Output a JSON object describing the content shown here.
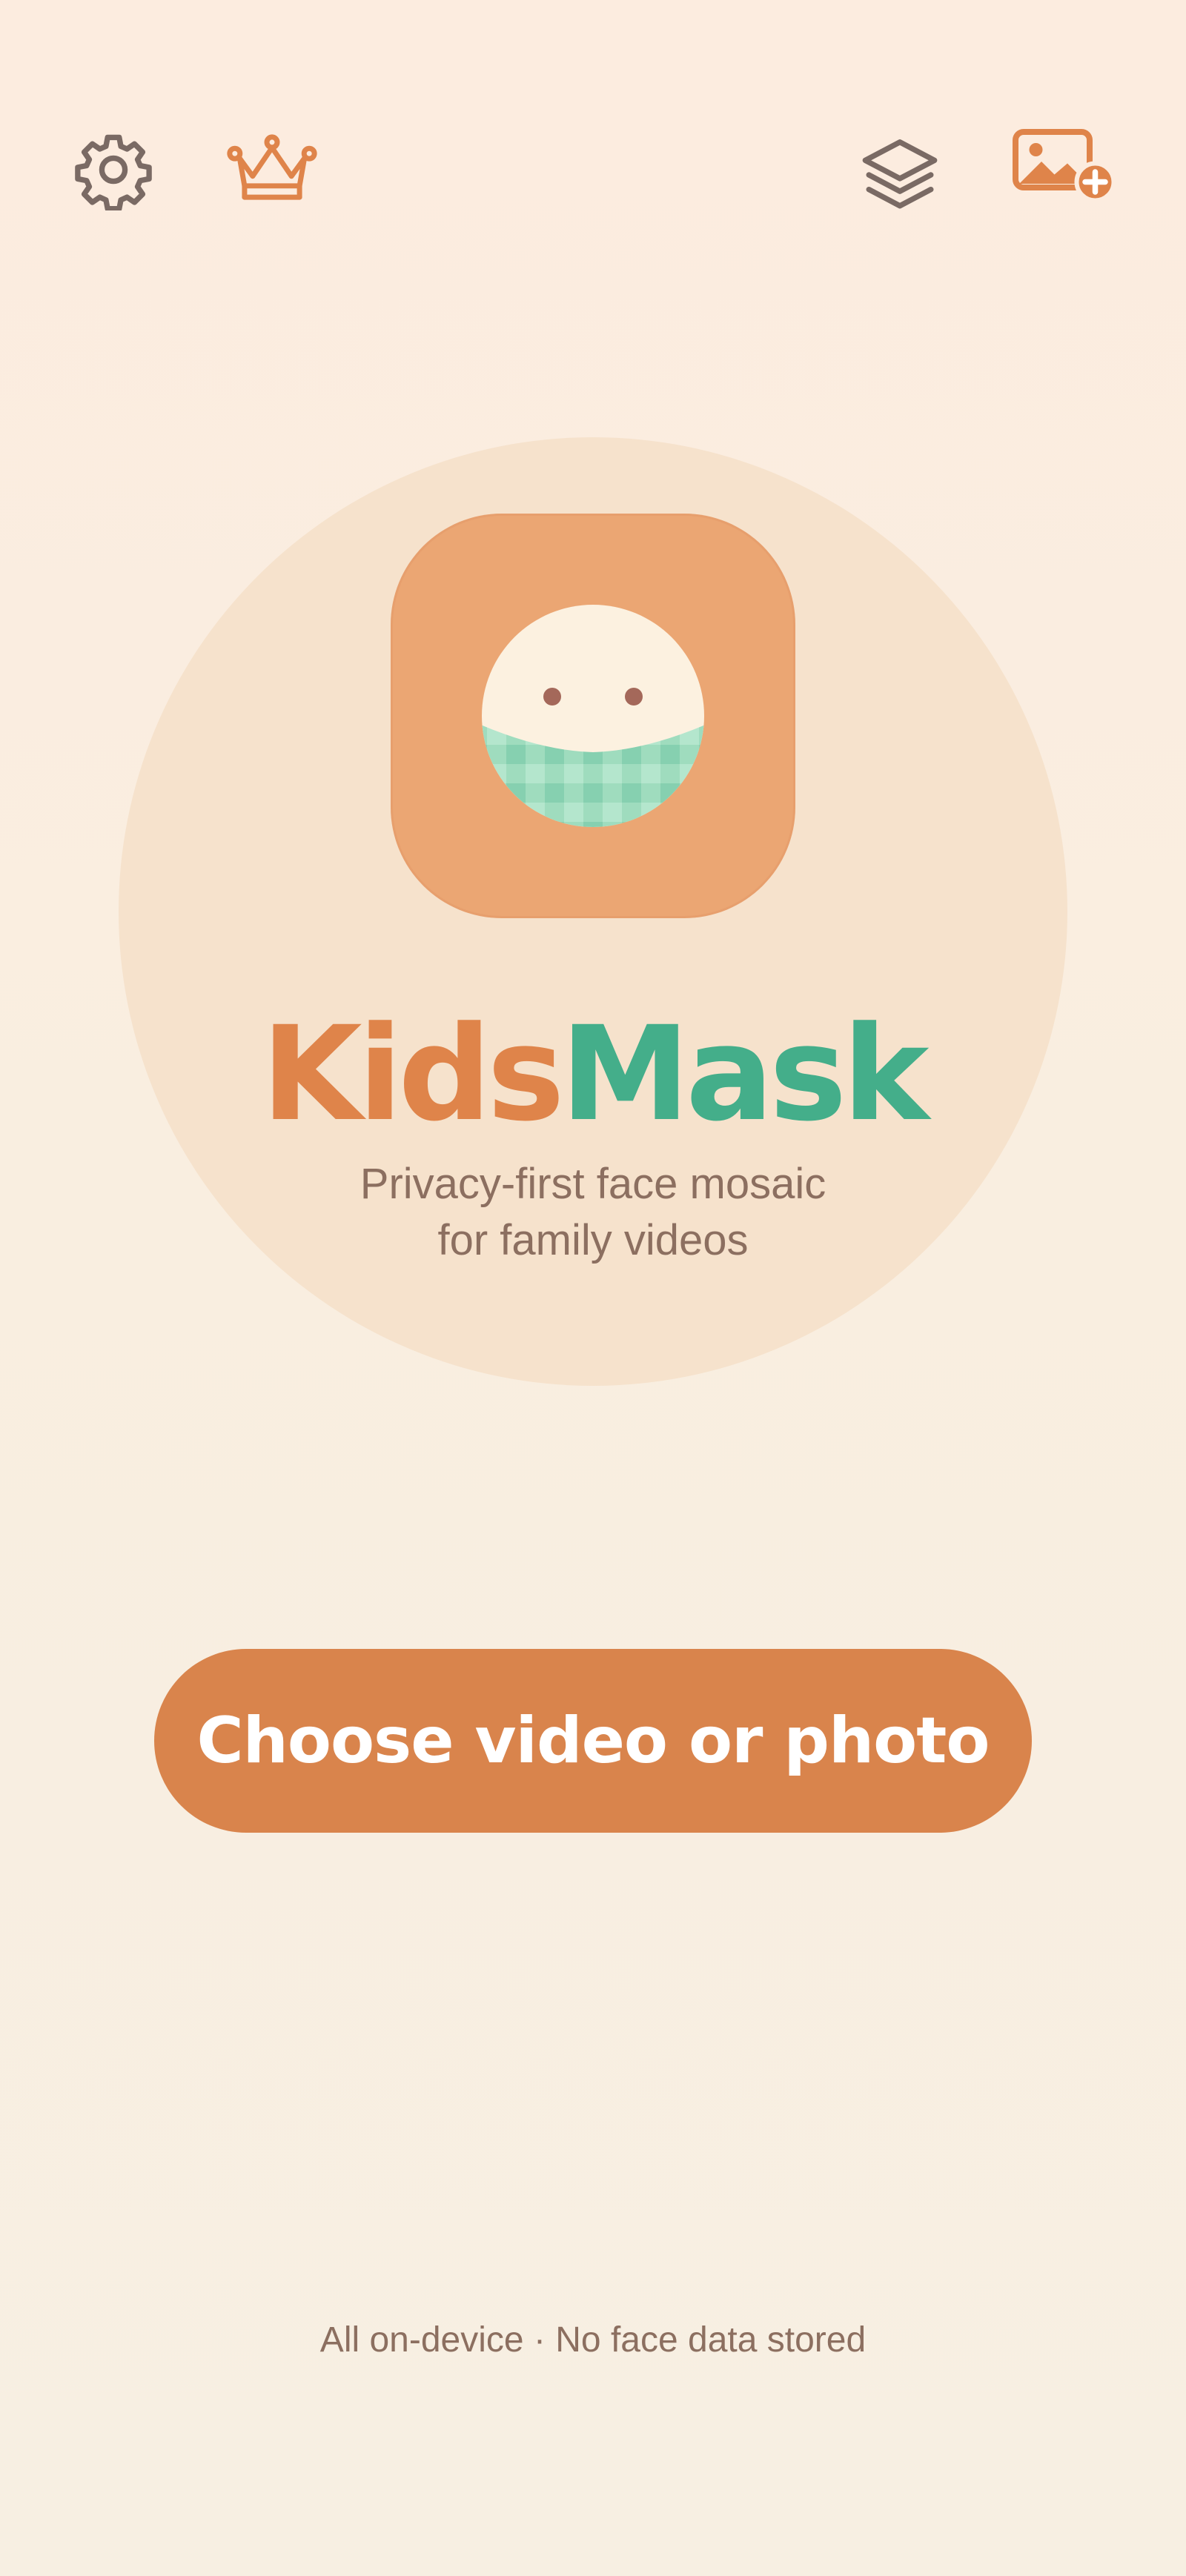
{
  "topbar": {
    "settings_icon": "gear-icon",
    "premium_icon": "crown-icon",
    "layers_icon": "layers-icon",
    "add_media_icon": "add-image-icon"
  },
  "hero": {
    "brand_part1": "Kids",
    "brand_part2": "Mask",
    "tagline_line1": "Privacy-first face mosaic",
    "tagline_line2": "for family videos"
  },
  "cta": {
    "label": "Choose video or photo"
  },
  "footer": {
    "note": "All on-device · No face data stored"
  },
  "colors": {
    "background": "#fcecdf",
    "accent_orange": "#d9844c",
    "accent_green": "#44ae8a",
    "icon_gray": "#7a6a64",
    "text_muted": "#8c6f60"
  }
}
